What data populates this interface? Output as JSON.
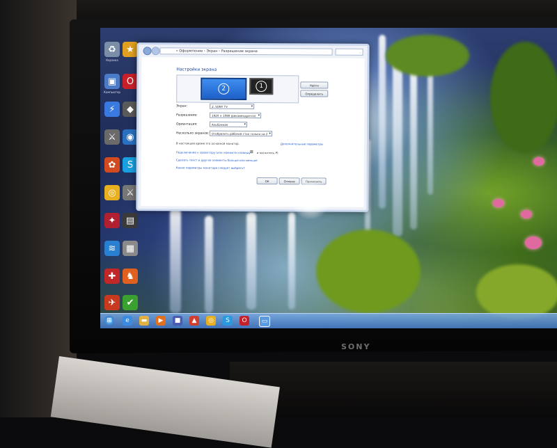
{
  "tv": {
    "brand": "SONY"
  },
  "dialog": {
    "address": "« Оформление › Экран › Разрешение экрана",
    "search_placeholder": "Поиск в панели управления",
    "heading": "Настройки экрана",
    "monitors": [
      {
        "number": "2"
      },
      {
        "number": "1"
      }
    ],
    "detect_button": "Найти",
    "identify_button": "Определить",
    "rows": [
      {
        "label": "Экран:",
        "value": "2. SONY TV"
      },
      {
        "label": "Разрешение:",
        "value": "1920 × 1080 (рекомендуется)"
      },
      {
        "label": "Ориентация:",
        "value": "Альбомная"
      },
      {
        "label": "Несколько экранов:",
        "value": "Отобразить рабочий стол только на 2"
      }
    ],
    "main_monitor_text": "В настоящее время это основной монитор.",
    "advanced_link": "Дополнительные параметры",
    "projector_link": "Подключение к проектору (или нажмите клавишу",
    "projector_suffix": "и коснитесь P)",
    "text_size_link": "Сделать текст и другие элементы больше или меньше",
    "which_settings_link": "Какие параметры монитора следует выбрать?",
    "ok_button": "ОК",
    "cancel_button": "Отмена",
    "apply_button": "Применить"
  },
  "desktop_icons": [
    {
      "name": "recycle-bin-icon",
      "label": "Корзина"
    },
    {
      "name": "app-icon",
      "label": ""
    },
    {
      "name": "computer-icon",
      "label": "Компьютер"
    },
    {
      "name": "opera-icon",
      "label": ""
    },
    {
      "name": "skype-icon",
      "label": ""
    },
    {
      "name": "chrome-icon",
      "label": ""
    },
    {
      "name": "game-icon",
      "label": ""
    },
    {
      "name": "network-icon",
      "label": ""
    }
  ],
  "taskbar": {
    "icons": [
      "start-orb-icon",
      "ie-icon",
      "folder-icon",
      "media-player-icon",
      "app-icon",
      "chrome-icon",
      "app-icon",
      "opera-icon",
      "monitor-icon"
    ]
  }
}
